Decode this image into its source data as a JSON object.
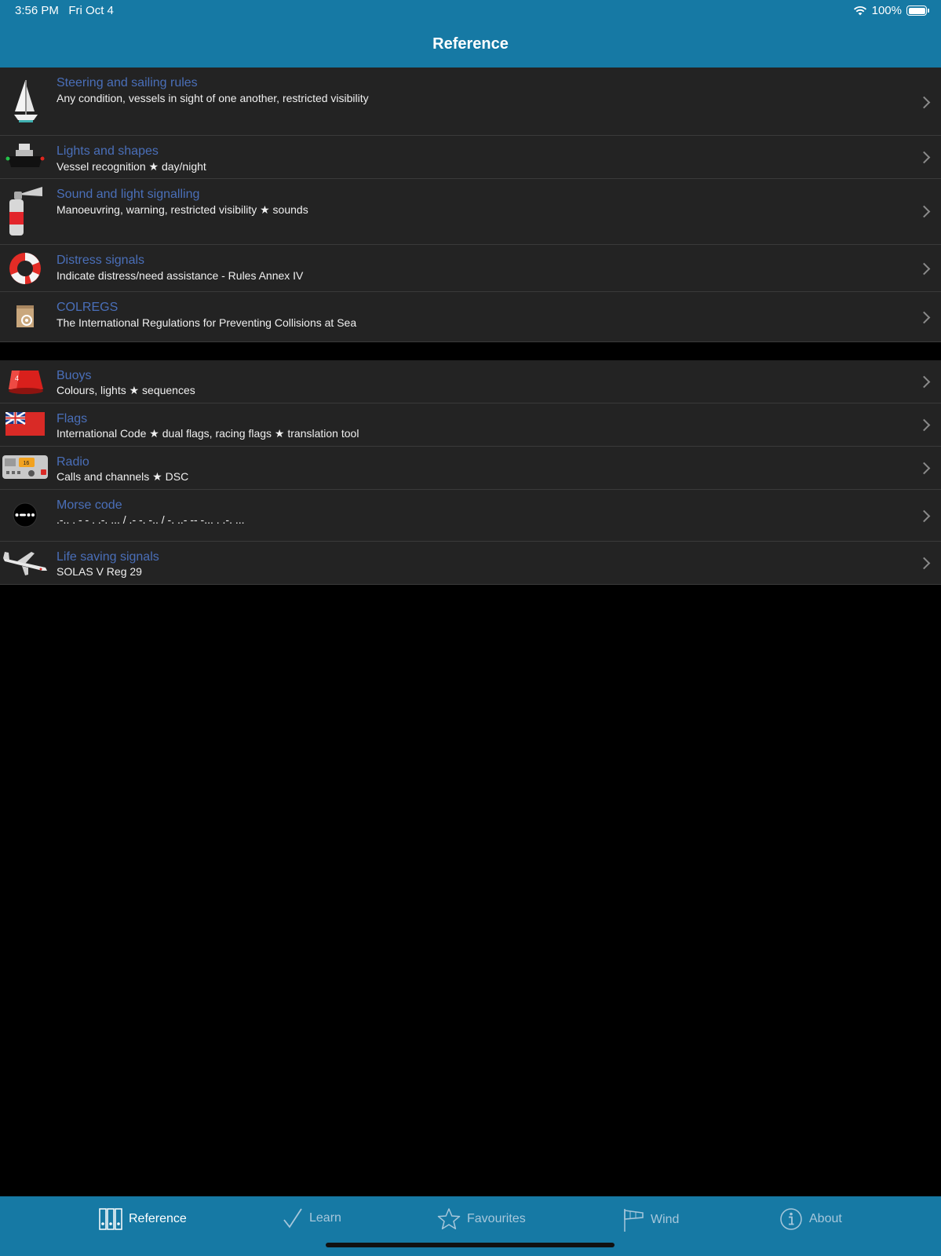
{
  "status_bar": {
    "time": "3:56 PM",
    "date": "Fri Oct 4",
    "battery": "100%"
  },
  "nav": {
    "title": "Reference"
  },
  "section1": [
    {
      "title": "Steering and sailing rules",
      "subtitle": "Any condition, vessels in sight of one another, restricted visibility",
      "icon": "sailboat-icon"
    },
    {
      "title": "Lights and shapes",
      "subtitle": "Vessel recognition ★ day/night",
      "icon": "vessel-lights-icon"
    },
    {
      "title": "Sound and light signalling",
      "subtitle": "Manoeuvring, warning, restricted visibility ★ sounds",
      "icon": "air-horn-icon"
    },
    {
      "title": "Distress signals",
      "subtitle": "Indicate distress/need assistance - Rules Annex IV",
      "icon": "lifebuoy-icon"
    },
    {
      "title": "COLREGS",
      "subtitle": "The International Regulations for Preventing Collisions at Sea",
      "icon": "colregs-book-icon"
    }
  ],
  "section2": [
    {
      "title": "Buoys",
      "subtitle": "Colours, lights ★ sequences",
      "icon": "buoy-icon"
    },
    {
      "title": "Flags",
      "subtitle": "International Code ★ dual flags, racing flags ★ translation tool",
      "icon": "red-ensign-flag-icon"
    },
    {
      "title": "Radio",
      "subtitle": "Calls and channels ★ DSC",
      "icon": "vhf-radio-icon",
      "radio_channel": "16"
    },
    {
      "title": "Morse code",
      "subtitle": ".-.. . - - . .-. ... / .- -. -.. / -. ..- -- -... . .-. ...",
      "icon": "morse-code-icon"
    },
    {
      "title": "Life saving signals",
      "subtitle": "SOLAS V Reg 29",
      "icon": "airplane-icon"
    }
  ],
  "tabs": [
    {
      "label": "Reference",
      "icon": "binders-icon",
      "active": true
    },
    {
      "label": "Learn",
      "icon": "checkmark-icon",
      "active": false
    },
    {
      "label": "Favourites",
      "icon": "star-icon",
      "active": false
    },
    {
      "label": "Wind",
      "icon": "windsock-icon",
      "active": false
    },
    {
      "label": "About",
      "icon": "info-icon",
      "active": false
    }
  ],
  "colors": {
    "bar": "#1679a4",
    "row_bg": "#232323",
    "title_text": "#4a6fb9",
    "subtitle_text": "#f0f0f0"
  }
}
